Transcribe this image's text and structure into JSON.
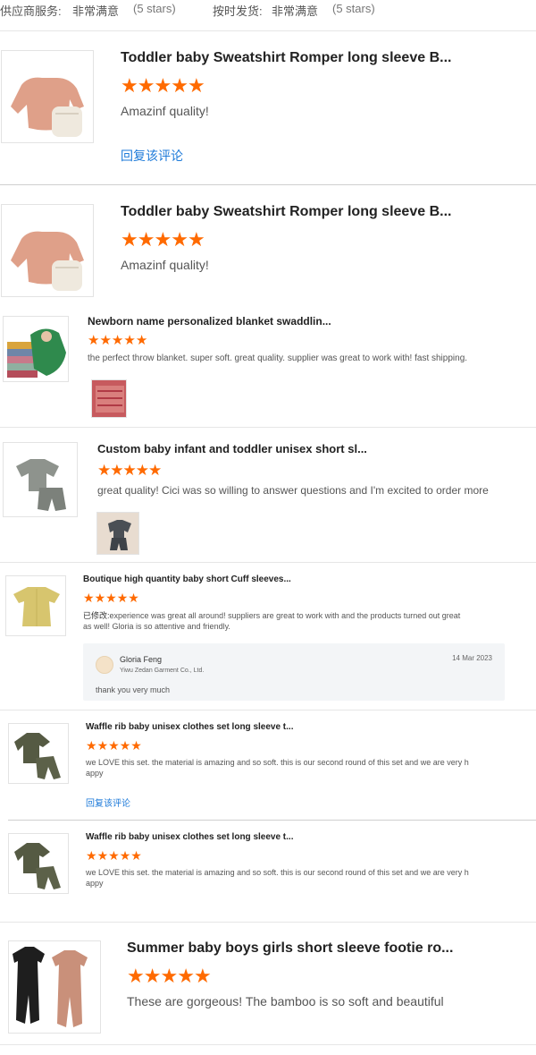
{
  "header": {
    "supplier_service_label": "供应商服务:",
    "supplier_service_value": "非常满意",
    "supplier_service_stars": "(5 stars)",
    "delivery_label": "按时发货:",
    "delivery_value": "非常满意",
    "delivery_stars": "(5 stars)"
  },
  "colors": {
    "star": "#ff6a00",
    "link": "#1d7ad9"
  },
  "reviews": [
    {
      "title": "Toddler baby Sweatshirt Romper long sleeve B...",
      "rating": 5,
      "text": "Amazinf quality!",
      "reply_link": "回复该评论"
    },
    {
      "title": "Toddler baby Sweatshirt Romper long sleeve B...",
      "rating": 5,
      "text": "Amazinf quality!"
    },
    {
      "title": "Newborn name personalized blanket swaddlin...",
      "rating": 5,
      "text": "the perfect throw blanket. super soft. great quality. supplier was great to work with! fast shipping."
    },
    {
      "title": "Custom baby infant and toddler unisex short sl...",
      "rating": 5,
      "text": "great quality! Cici was so willing to answer questions and I'm excited to order more"
    },
    {
      "title": "Boutique high quantity baby short Cuff sleeves...",
      "rating": 5,
      "edited_label": "已修改:",
      "text_line1": "experience was great all around! suppliers are great to work with and the products turned out great",
      "text_line2": "as well! Gloria is so attentive and friendly.",
      "reply": {
        "name": "Gloria Feng",
        "company": "Yiwu Zedan Garment Co., Ltd.",
        "date": "14 Mar 2023",
        "text": "thank you very much"
      }
    },
    {
      "title": "Waffle rib baby unisex clothes set long sleeve t...",
      "rating": 5,
      "text_line1": "we LOVE this set. the material is amazing and so soft. this is our second round of this set and we are very h",
      "text_line2": "appy",
      "reply_link": "回复该评论"
    },
    {
      "title": "Waffle rib baby unisex clothes set long sleeve t...",
      "rating": 5,
      "text_line1": "we LOVE this set. the material is amazing and so soft. this is our second round of this set and we are very h",
      "text_line2": "appy"
    },
    {
      "title": "Summer baby boys girls short sleeve footie ro...",
      "rating": 5,
      "text": "These are gorgeous! The bamboo is so soft and beautiful"
    }
  ]
}
